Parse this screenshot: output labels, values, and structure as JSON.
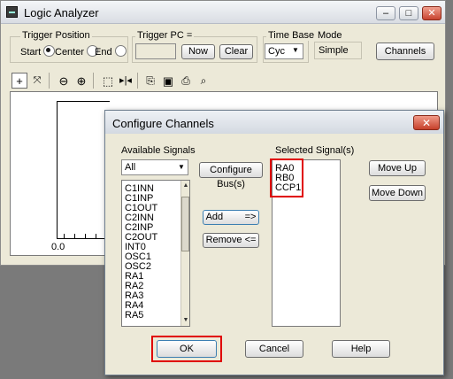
{
  "logic_analyzer": {
    "title": "Logic Analyzer",
    "controls": {
      "minimize": "–",
      "restore": "□",
      "close": "✕"
    },
    "trigger_position": {
      "label": "Trigger Position",
      "options": [
        "Start",
        "Center",
        "End"
      ],
      "selected": "Start"
    },
    "trigger_pc": {
      "label": "Trigger PC =",
      "value": "",
      "now_label": "Now",
      "clear_label": "Clear"
    },
    "time_base": {
      "label": "Time Base",
      "value": "Cyc"
    },
    "mode": {
      "label": "Mode",
      "value": "Simple"
    },
    "channels_label": "Channels",
    "chart": {
      "x_tick": "0.0"
    }
  },
  "configure_channels": {
    "title": "Configure Channels",
    "available": {
      "label": "Available Signals",
      "filter": "All",
      "items": [
        "C1INN",
        "C1INP",
        "C1OUT",
        "C2INN",
        "C2INP",
        "C2OUT",
        "INT0",
        "OSC1",
        "OSC2",
        "RA1",
        "RA2",
        "RA3",
        "RA4",
        "RA5"
      ]
    },
    "configure_bus_label": "Configure Bus(s)",
    "add_label": "Add        =>",
    "remove_label": "Remove <=",
    "selected": {
      "label": "Selected Signal(s)",
      "items": [
        "RA0",
        "RB0",
        "CCP1"
      ]
    },
    "move_up_label": "Move Up",
    "move_down_label": "Move Down",
    "ok_label": "OK",
    "cancel_label": "Cancel",
    "help_label": "Help",
    "highlight_color": "#e00000"
  }
}
